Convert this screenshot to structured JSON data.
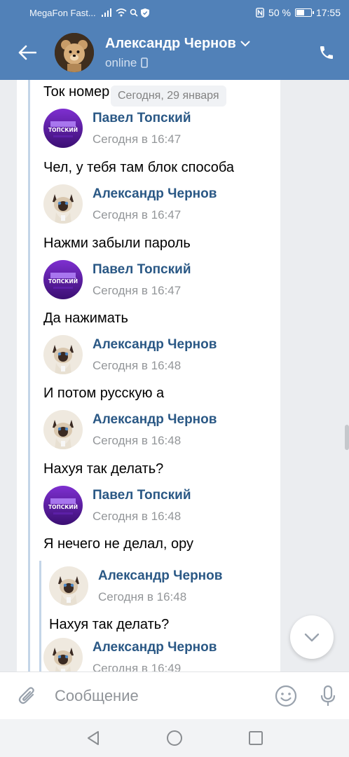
{
  "status_bar": {
    "carrier": "MegaFon Fast...",
    "battery": "50 %",
    "battery_level": 0.5,
    "time": "17:55"
  },
  "header": {
    "name": "Александр Чернов",
    "status": "online"
  },
  "date_separator": "Сегодня, 29 января",
  "messages": [
    {
      "text": "Ток номер"
    },
    {
      "author": "Павел Топский",
      "time": "Сегодня в 16:47",
      "avatar": "pavel-avatar",
      "text": "Чел, у тебя там блок способа"
    },
    {
      "author": "Александр Чернов",
      "time": "Сегодня в 16:47",
      "avatar": "cat-avatar",
      "text": "Нажми забыли пароль"
    },
    {
      "author": "Павел Топский",
      "time": "Сегодня в 16:47",
      "avatar": "pavel-avatar",
      "text": "Да нажимать"
    },
    {
      "author": "Александр Чернов",
      "time": "Сегодня в 16:48",
      "avatar": "cat-avatar",
      "text": "И потом русскую а"
    },
    {
      "author": "Александр Чернов",
      "time": "Сегодня в 16:48",
      "avatar": "cat-avatar",
      "text": "Нахуя так делать?"
    },
    {
      "author": "Павел Топский",
      "time": "Сегодня в 16:48",
      "avatar": "pavel-avatar",
      "text": "Я нечего не делал, ору"
    },
    {
      "author": "Александр Чернов",
      "time": "Сегодня в 16:48",
      "avatar": "cat-avatar",
      "text": "Нахуя так делать?"
    },
    {
      "author": "Александр Чернов",
      "time": "Сегодня в 16:49",
      "avatar": "cat-avatar"
    }
  ],
  "avatar_badge": "ТОПСКИЙ",
  "composer": {
    "placeholder": "Сообщение"
  },
  "colors": {
    "header_bg": "#5181b8",
    "author_name": "#2a5885",
    "timestamp": "#939699",
    "forward_line": "#c4d5e8"
  }
}
